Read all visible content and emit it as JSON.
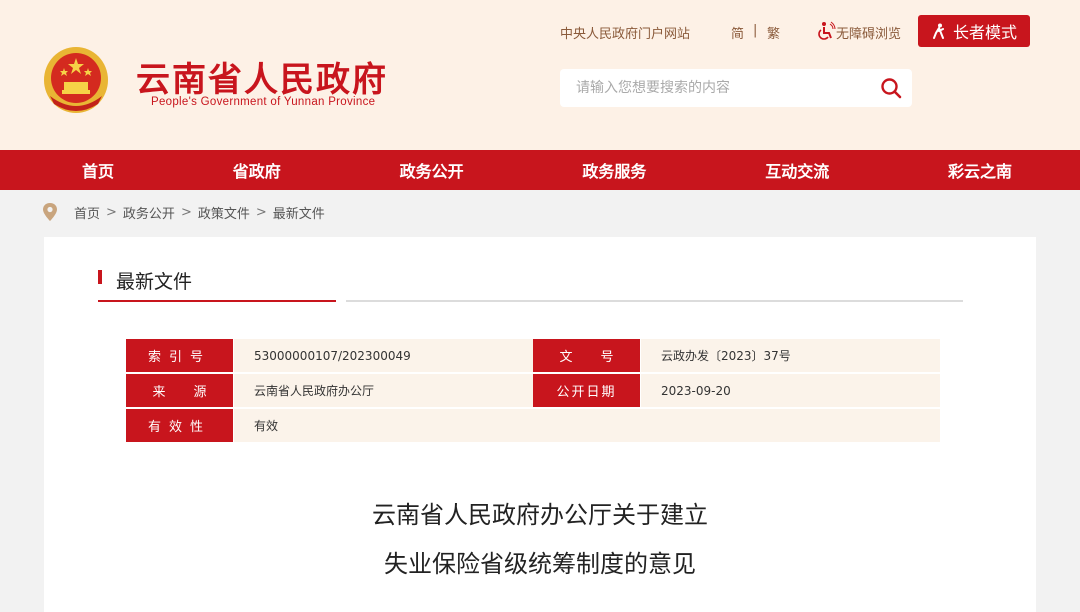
{
  "header": {
    "site_title": "云南省人民政府",
    "site_subtitle": "People's Government of Yunnan Province",
    "top_links": {
      "central_portal": "中央人民政府门户网站",
      "simplified": "简",
      "separator": "|",
      "traditional": "繁",
      "accessibility": "无障碍浏览"
    },
    "elder_mode": "长者模式",
    "search_placeholder": "请输入您想要搜索的内容"
  },
  "nav": {
    "items": [
      "首页",
      "省政府",
      "政务公开",
      "政务服务",
      "互动交流",
      "彩云之南"
    ]
  },
  "breadcrumb": {
    "items": [
      "首页",
      "政务公开",
      "政策文件",
      "最新文件"
    ],
    "separator": ">"
  },
  "section": {
    "title": "最新文件"
  },
  "meta": {
    "index_label": "索引号",
    "index_value": "53000000107/202300049",
    "doc_no_label": "文号",
    "doc_no_value": "云政办发〔2023〕37号",
    "source_label": "来源",
    "source_value": "云南省人民政府办公厅",
    "date_label": "公开日期",
    "date_value": "2023-09-20",
    "validity_label": "有效性",
    "validity_value": "有效"
  },
  "document": {
    "title_line1": "云南省人民政府办公厅关于建立",
    "title_line2": "失业保险省级统筹制度的意见"
  },
  "colors": {
    "brand_red": "#c8151d",
    "header_bg": "#fdf1e6",
    "meta_value_bg": "#fbf3ea"
  }
}
